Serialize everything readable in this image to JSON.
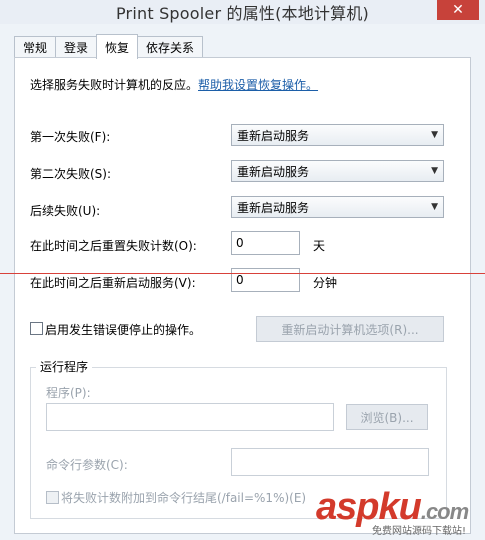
{
  "window": {
    "title": "Print Spooler 的属性(本地计算机)",
    "close_glyph": "✕"
  },
  "tabs": [
    {
      "label": "常规"
    },
    {
      "label": "登录"
    },
    {
      "label": "恢复"
    },
    {
      "label": "依存关系"
    }
  ],
  "recovery": {
    "intro": "选择服务失败时计算机的反应。",
    "help_link": "帮助我设置恢复操作。",
    "first_failure": {
      "label": "第一次失败(F):",
      "value": "重新启动服务"
    },
    "second_failure": {
      "label": "第二次失败(S):",
      "value": "重新启动服务"
    },
    "subsequent_failures": {
      "label": "后续失败(U):",
      "value": "重新启动服务"
    },
    "reset_count": {
      "label": "在此时间之后重置失败计数(O):",
      "value": "0",
      "unit": "天"
    },
    "restart_service": {
      "label": "在此时间之后重新启动服务(V):",
      "value": "0",
      "unit": "分钟"
    },
    "enable_actions": {
      "label": "启用发生错误便停止的操作。",
      "checked": false
    },
    "restart_computer_button": "重新启动计算机选项(R)...",
    "run_program": {
      "legend": "运行程序",
      "program_label": "程序(P):",
      "program_value": "",
      "browse_button": "浏览(B)...",
      "cmd_label": "命令行参数(C):",
      "cmd_value": "",
      "append_label": "将失败计数附加到命令行结尾(/fail=%1%)(E)",
      "append_checked": false
    }
  },
  "watermark": {
    "brand": "aspku",
    "suffix": ".com",
    "sub": "免费网站源码下载站!"
  },
  "colors": {
    "link": "#1c5ea8",
    "watermark": "#d33a2b",
    "red_line": "#d8413a"
  }
}
